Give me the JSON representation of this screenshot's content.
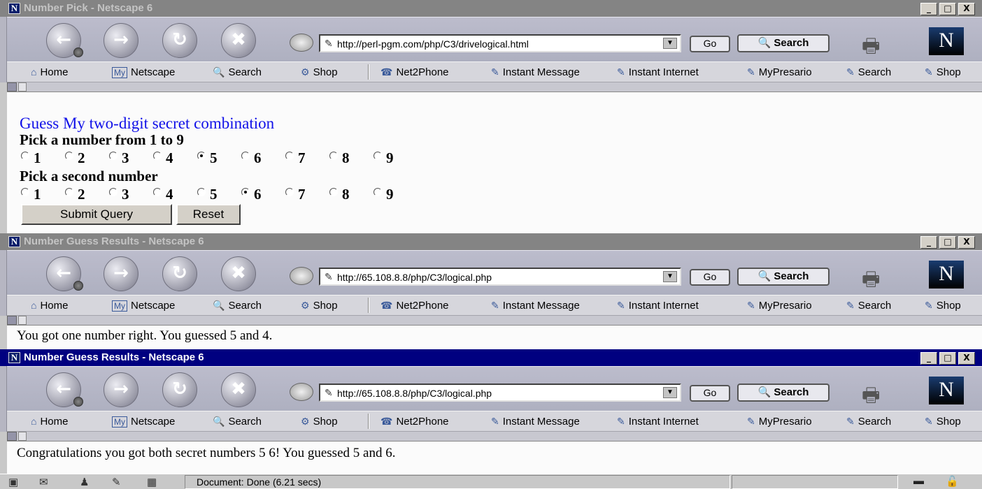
{
  "windows": [
    {
      "title": "Number Pick - Netscape 6",
      "active": false,
      "url": "http://perl-pgm.com/php/C3/drivelogical.html",
      "page": {
        "heading": "Guess My two-digit secret combination",
        "question1": "Pick a number from 1 to 9",
        "question2": "Pick a second number",
        "options": [
          "1",
          "2",
          "3",
          "4",
          "5",
          "6",
          "7",
          "8",
          "9"
        ],
        "selected1": "5",
        "selected2": "6",
        "submit_label": "Submit Query",
        "reset_label": "Reset"
      }
    },
    {
      "title": "Number Guess Results - Netscape 6",
      "active": false,
      "url": "http://65.108.8.8/php/C3/logical.php",
      "message": "You got one number right. You guessed 5 and 4."
    },
    {
      "title": "Number Guess Results - Netscape 6",
      "active": true,
      "url": "http://65.108.8.8/php/C3/logical.php",
      "message": "Congratulations you got both secret numbers 5 6! You guessed 5 and 6."
    }
  ],
  "toolbar": {
    "go_label": "Go",
    "search_label": "Search",
    "brand_letter": "N",
    "window_buttons": [
      "_",
      "□",
      "X"
    ]
  },
  "personal_toolbar": {
    "items": [
      {
        "label": "Home",
        "icon": "home-icon"
      },
      {
        "label": "Netscape",
        "icon": "my-netscape-icon",
        "prefix": "My"
      },
      {
        "label": "Search",
        "icon": "search-icon"
      },
      {
        "label": "Shop",
        "icon": "shop-icon"
      },
      {
        "label": "Net2Phone",
        "icon": "net2phone-icon"
      },
      {
        "label": "Instant Message",
        "icon": "bookmark-icon"
      },
      {
        "label": "Instant Internet",
        "icon": "bookmark-icon"
      },
      {
        "label": "MyPresario",
        "icon": "bookmark-icon"
      },
      {
        "label": "Search",
        "icon": "bookmark-icon"
      },
      {
        "label": "Shop",
        "icon": "bookmark-icon"
      }
    ]
  },
  "statusbar": {
    "text": "Document: Done (6.21 secs)"
  },
  "colors": {
    "active_title": "#000080",
    "inactive_title": "#848484",
    "heading": "#1010e8"
  }
}
